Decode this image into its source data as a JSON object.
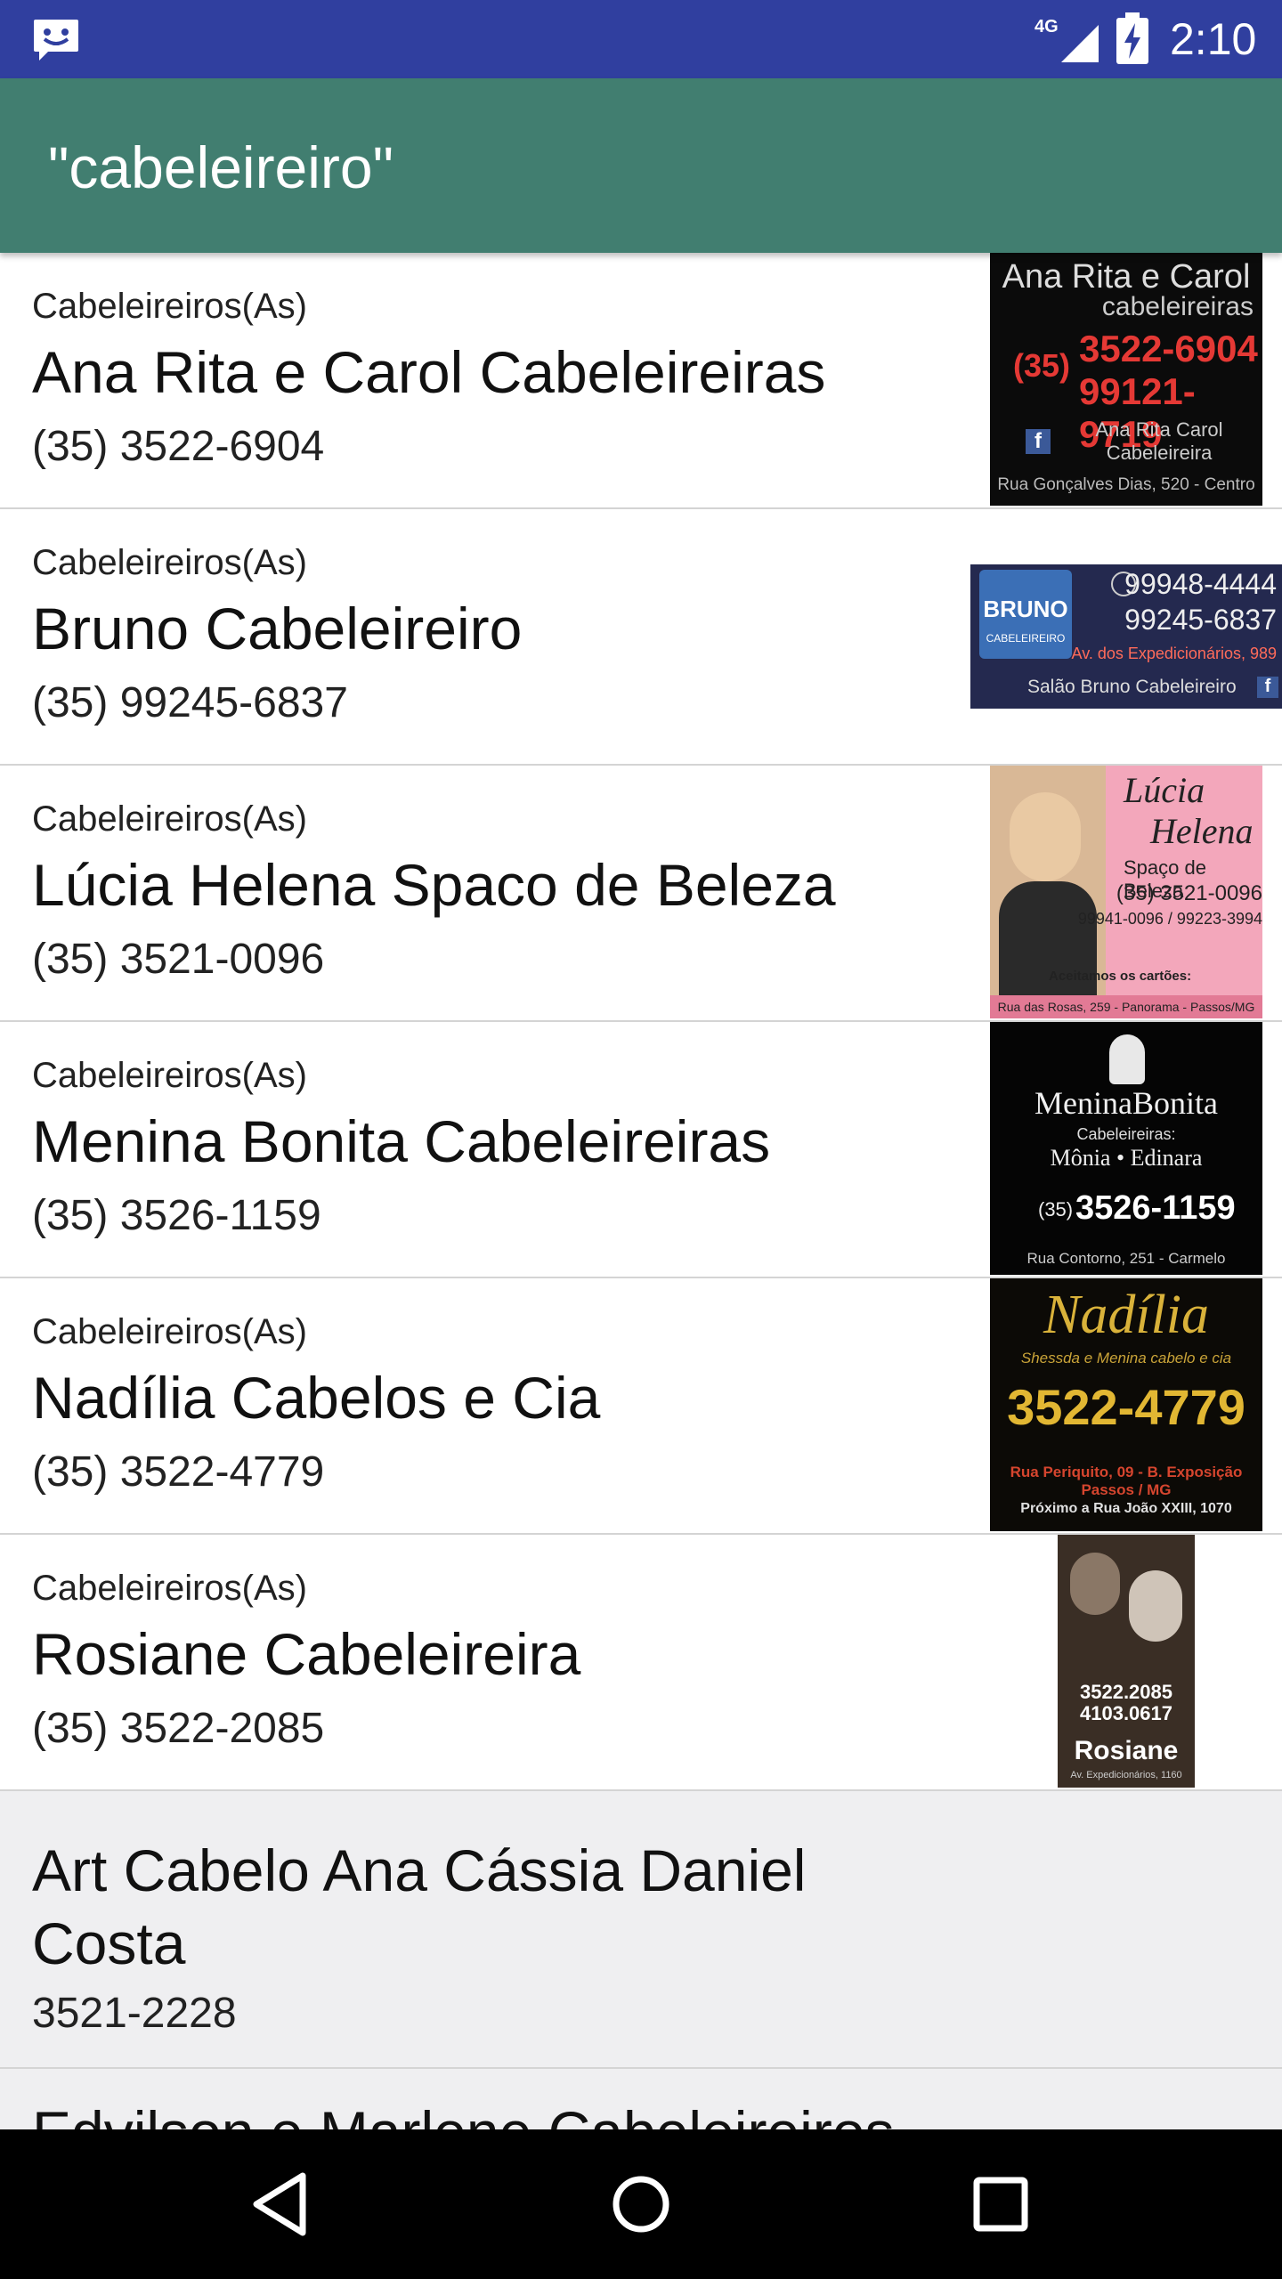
{
  "status_bar": {
    "network": "4G",
    "time": "2:10",
    "color": "#303F9F"
  },
  "app_bar": {
    "title": "\"cabeleireiro\"",
    "color": "#417E70"
  },
  "results": [
    {
      "category": "Cabeleireiros(As)",
      "name": "Ana Rita e Carol Cabeleireiras",
      "phone": "(35) 3522-6904",
      "ad": {
        "title": "Ana Rita e Carol",
        "subtitle": "cabeleireiras",
        "area": "(35)",
        "phone1": "3522-6904",
        "phone2": "99121-9719",
        "social": "Ana Rita Carol Cabeleireira",
        "address": "Rua Gonçalves Dias, 520 - Centro"
      }
    },
    {
      "category": "Cabeleireiros(As)",
      "name": "Bruno Cabeleireiro",
      "phone": "(35) 99245-6837",
      "ad": {
        "logo": "BRUNO",
        "logo_sub": "CABELEIREIRO",
        "phone1": "99948-4444",
        "phone2": "99245-6837",
        "address": "Av. dos Expedicionários, 989",
        "social": "Salão Bruno Cabeleireiro"
      }
    },
    {
      "category": "Cabeleireiros(As)",
      "name": "Lúcia Helena Spaco de Beleza",
      "phone": "(35) 3521-0096",
      "ad": {
        "title1": "Lúcia",
        "title2": "Helena",
        "subtitle": "Spaço de Beleza",
        "phone1": "(35) 3521-0096",
        "phone2": "99941-0096 / 99223-3994",
        "cards": "Aceitamos os cartões:",
        "address": "Rua das Rosas, 259 - Panorama - Passos/MG"
      }
    },
    {
      "category": "Cabeleireiros(As)",
      "name": "Menina Bonita Cabeleireiras",
      "phone": "(35) 3526-1159",
      "ad": {
        "title": "MeninaBonita",
        "subtitle": "Cabeleireiras:",
        "names": "Mônia • Edinara",
        "area": "(35)",
        "phone": "3526-1159",
        "address": "Rua Contorno, 251 - Carmelo"
      }
    },
    {
      "category": "Cabeleireiros(As)",
      "name": "Nadília Cabelos e Cia",
      "phone": "(35) 3522-4779",
      "ad": {
        "title": "Nadília",
        "slogan": "Shessda e Menina cabelo e cia",
        "phone": "3522-4779",
        "address1": "Rua Periquito, 09 - B. Exposição",
        "address2": "Passos / MG",
        "address3": "Próximo a Rua João XXIII, 1070"
      }
    },
    {
      "category": "Cabeleireiros(As)",
      "name": "Rosiane Cabeleireira",
      "phone": "(35) 3522-2085",
      "ad": {
        "phone1": "3522.2085",
        "phone2": "4103.0617",
        "title": "Rosiane",
        "address": "Av. Expedicionários, 1160"
      }
    },
    {
      "name": "Art Cabelo Ana Cássia Daniel Costa",
      "phone": "3521-2228"
    },
    {
      "name": "Edvilson e Marlene Cabeleireiros"
    }
  ],
  "nav_bar": {
    "back": "back-icon",
    "home": "home-icon",
    "recents": "recents-icon"
  }
}
